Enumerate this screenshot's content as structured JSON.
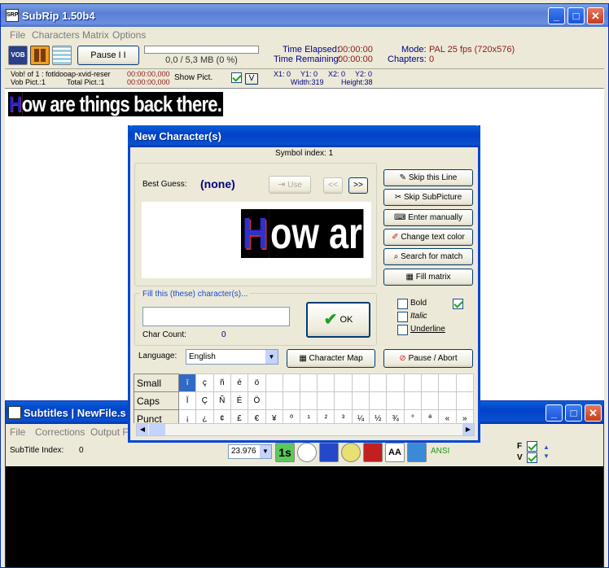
{
  "main_window": {
    "title": "SubRip 1.50b4",
    "menu": [
      "File",
      "Characters Matrix",
      "Options"
    ],
    "icon_text": "SRP"
  },
  "toolbar": {
    "vob_label": "VOB",
    "pause_label": "Pause  I I",
    "progress_text": "0,0 / 5,3 MB (0 %)",
    "progress_fraction": 0,
    "time_elapsed_label": "Time Elapsed:",
    "time_elapsed_value": "00:00:00",
    "time_remaining_label": "Time Remaining:",
    "time_remaining_value": "00:00:00",
    "mode_label": "Mode:",
    "mode_value": "PAL 25 fps (720x576)",
    "chapters_label": "Chapters:",
    "chapters_value": "0"
  },
  "info_bar": {
    "vob_line": "Vob! of 1 : fotldooap-xvid-reser",
    "vob_time": "00:00:00,000",
    "vob_pict_label": "Vob Pict.:1",
    "total_pict_label": "Total Pict.:1",
    "total_time": "00:00:00,000",
    "show_pict_label": "Show Pict.",
    "v_label": "V",
    "x1": "X1: 0",
    "y1": "Y1: 0",
    "x2": "X2: 0",
    "y2": "Y2: 0",
    "width": "Width:319",
    "height": "Height:38"
  },
  "subtitle_preview": {
    "first_letter": "H",
    "rest": "ow are things back there."
  },
  "dialog": {
    "title": "New Character(s)",
    "symbol_index": "Symbol index: 1",
    "best_guess_label": "Best Guess:",
    "best_guess_value": "(none)",
    "use_label": "Use",
    "prev_label": "<<",
    "next_label": ">>",
    "preview_first": "H",
    "preview_rest": "ow ar",
    "fill_label": "Fill this (these) character(s)...",
    "fill_value": "",
    "char_count_label": "Char Count:",
    "char_count_value": "0",
    "ok_label": "OK",
    "buttons": {
      "skip_line": "Skip this Line",
      "skip_subpicture": "Skip SubPicture",
      "enter_manually": "Enter manually",
      "change_text_color": "Change text color",
      "search_match": "Search for match",
      "fill_matrix": "Fill matrix"
    },
    "bold_label": "Bold",
    "italic_label": "Italic",
    "underline_label": "Underline",
    "language_label": "Language:",
    "language_value": "English",
    "character_map_label": "Character Map",
    "pause_abort_label": "Pause / Abort",
    "grid": {
      "small_label": "Small",
      "small": [
        "ï",
        "ç",
        "ñ",
        "é",
        "ö",
        "",
        "",
        "",
        "",
        "",
        "",
        "",
        "",
        "",
        "",
        "",
        ""
      ],
      "caps_label": "Caps",
      "caps": [
        "Ï",
        "Ç",
        "Ñ",
        "É",
        "Ö",
        "",
        "",
        "",
        "",
        "",
        "",
        "",
        "",
        "",
        "",
        "",
        ""
      ],
      "punct_label": "Punct",
      "punct": [
        "¡",
        "¿",
        "¢",
        "£",
        "€",
        "¥",
        "º",
        "¹",
        "²",
        "³",
        "¼",
        "½",
        "¾",
        "°",
        "ª",
        "«",
        "»"
      ]
    }
  },
  "subtitles_window": {
    "title": "Subtitles | NewFile.s",
    "menu": [
      "File",
      "Corrections",
      "Output Fo"
    ],
    "subtitle_index_label": "SubTitle Index:",
    "subtitle_index_value": "0",
    "fps_value": "23.976",
    "ansi_label": "ANSI",
    "f_label": "F",
    "v_label": "V"
  },
  "colors": {
    "title_blue": "#0a4fd0",
    "subtitle_text": "#ffffff",
    "first_letter": "#2020c0",
    "accent_maroon": "#8b1a1a"
  }
}
